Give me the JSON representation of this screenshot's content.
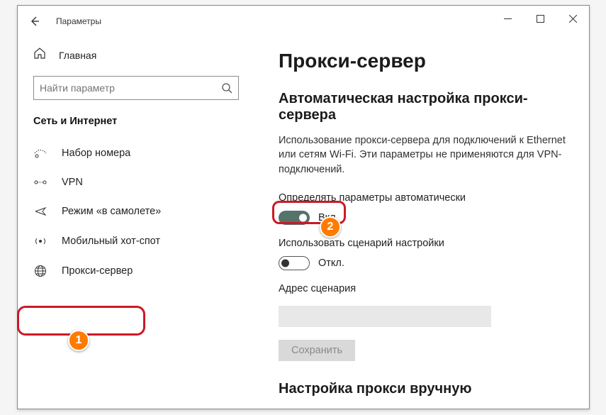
{
  "window": {
    "title": "Параметры"
  },
  "sidebar": {
    "home_label": "Главная",
    "search_placeholder": "Найти параметр",
    "category": "Сеть и Интернет",
    "items": [
      {
        "label": "Набор номера"
      },
      {
        "label": "VPN"
      },
      {
        "label": "Режим «в самолете»"
      },
      {
        "label": "Мобильный хот-спот"
      },
      {
        "label": "Прокси-сервер"
      }
    ]
  },
  "page": {
    "title": "Прокси-сервер",
    "auto_section": {
      "title": "Автоматическая настройка прокси-сервера",
      "desc": "Использование прокси-сервера для подключений к Ethernet или сетям Wi-Fi. Эти параметры не применяются для VPN-подключений.",
      "detect_label": "Определять параметры автоматически",
      "detect_state": "Вкл.",
      "script_label": "Использовать сценарий настройки",
      "script_state": "Откл.",
      "address_label": "Адрес сценария",
      "save_label": "Сохранить"
    },
    "manual_section": {
      "title_cutoff": "Настройка прокси вручную"
    }
  },
  "annotations": {
    "badge1": "1",
    "badge2": "2"
  }
}
